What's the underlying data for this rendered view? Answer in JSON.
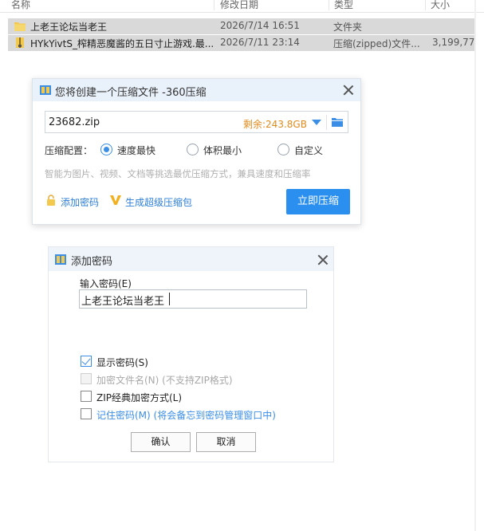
{
  "explorer": {
    "columns": [
      "名称",
      "修改日期",
      "类型",
      "大小"
    ],
    "rows": [
      {
        "icon": "folder-icon",
        "name": "上老王论坛当老王",
        "date": "2026/7/14 16:51",
        "type": "文件夹",
        "size": ""
      },
      {
        "icon": "zip-file-icon",
        "name": "HYkYivtS_榨精恶魔酱的五日寸止游戏.最...",
        "date": "2026/7/11 23:14",
        "type": "压缩(zipped)文件...",
        "size": "3,199,77"
      }
    ]
  },
  "compress_dialog": {
    "title": "您将创建一个压缩文件 -360压缩",
    "filename": "23682.zip",
    "free_space": "剩余:243.8GB",
    "config_label": "压缩配置：",
    "options": [
      "速度最快",
      "体积最小",
      "自定义"
    ],
    "selected_option": "速度最快",
    "hint": "智能为图片、视频、文档等挑选最优压缩方式，兼具速度和压缩率",
    "add_password_link": "添加密码",
    "super_compress_link": "生成超级压缩包",
    "compress_button": "立即压缩",
    "accent_color": "#2b8fef"
  },
  "password_dialog": {
    "title": "添加密码",
    "input_label": "输入密码(E)",
    "password_value": "上老王论坛当老王",
    "checkboxes": [
      {
        "label": "显示密码(S)",
        "checked": true,
        "disabled": false
      },
      {
        "label": "加密文件名(N) (不支持ZIP格式)",
        "checked": false,
        "disabled": true
      },
      {
        "label": "ZIP经典加密方式(L)",
        "checked": false,
        "disabled": false
      },
      {
        "label": "记住密码(M) (将会备忘到密码管理窗口中)",
        "checked": false,
        "disabled": false
      }
    ],
    "ok_button": "确认",
    "cancel_button": "取消"
  }
}
